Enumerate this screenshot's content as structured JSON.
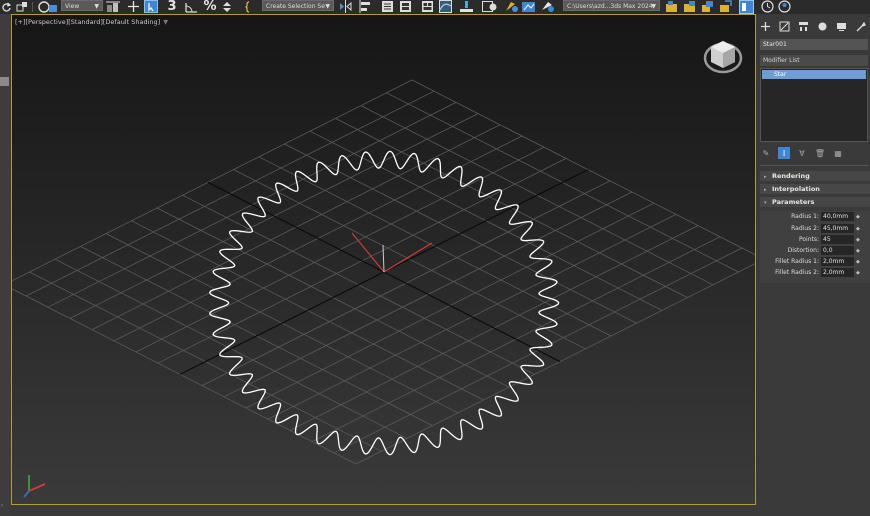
{
  "toolbar": {
    "view_dropdown": "View",
    "selection_set_dropdown": "Create Selection Se",
    "project_path": "C:\\Users\\azd...3ds Max 2024",
    "snap_toggle": "3",
    "percent_snap": "%"
  },
  "viewport": {
    "label": "[+][Perspective][Standard][Default Shading]",
    "filter_icon": "funnel-icon"
  },
  "star_shape": {
    "radius1": 40.0,
    "radius2": 45.0,
    "points": 45,
    "color": "#ffffff"
  },
  "colors": {
    "viewport_border": "#b49b3a",
    "selected_modifier": "#6d9fd4",
    "active_icon": "#3f87d6",
    "axis_x": "#d03a3a",
    "axis_y": "#3aa03a",
    "axis_z": "#3a6ad0"
  },
  "command_panel": {
    "object_name": "Star001",
    "modifier_list": "Modifier List",
    "stack": [
      "Star"
    ],
    "rollouts": {
      "rendering": "Rendering",
      "interpolation": "Interpolation",
      "parameters": "Parameters"
    },
    "params": [
      {
        "label": "Radius 1:",
        "value": "40,0mm"
      },
      {
        "label": "Radius 2:",
        "value": "45,0mm"
      },
      {
        "label": "Points:",
        "value": "45"
      },
      {
        "label": "Distortion:",
        "value": "0,0"
      },
      {
        "label": "Fillet Radius 1:",
        "value": "2,0mm"
      },
      {
        "label": "Fillet Radius 2:",
        "value": "2,0mm"
      }
    ]
  }
}
